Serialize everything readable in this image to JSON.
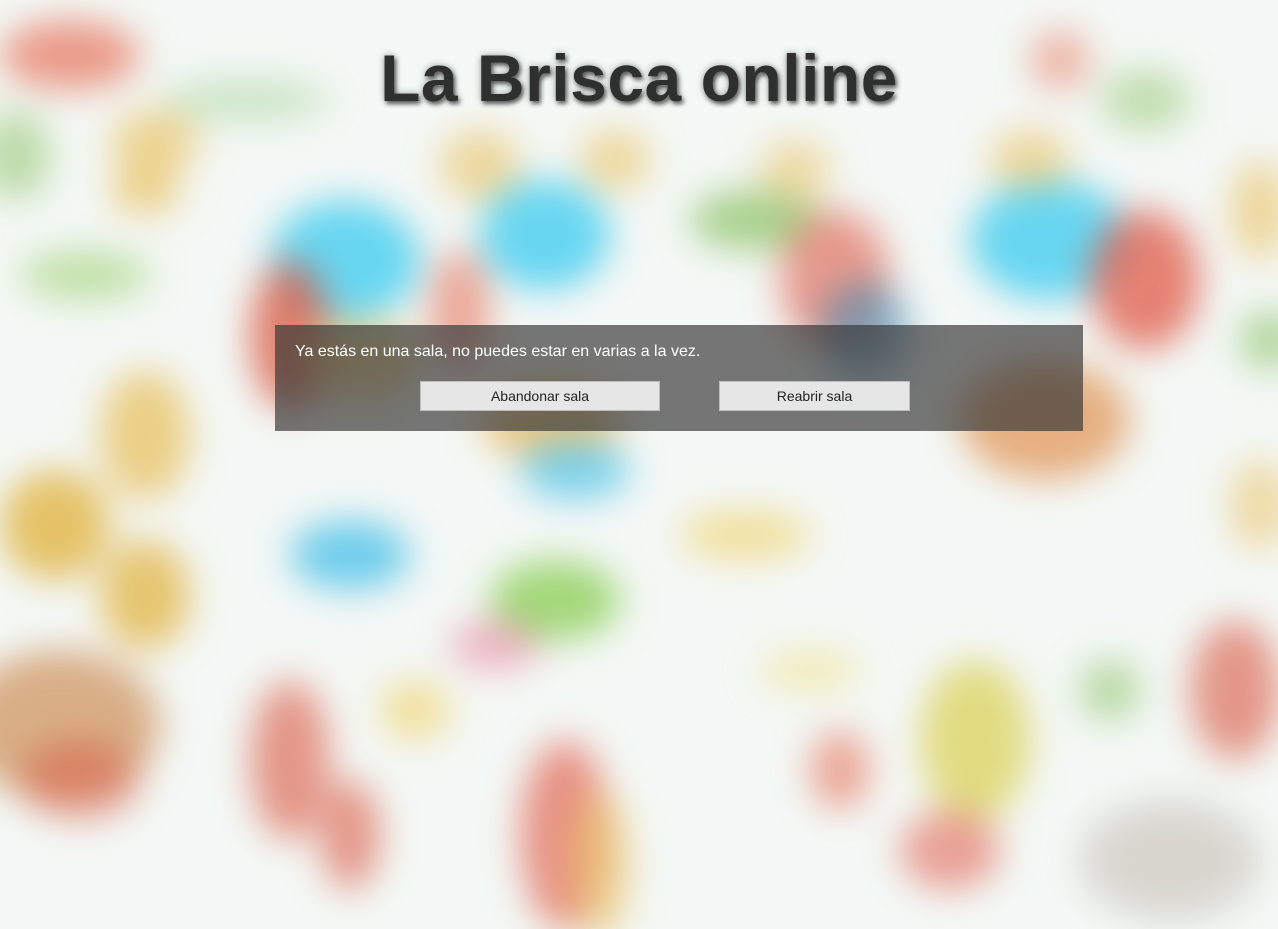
{
  "page": {
    "title": "La Brisca online"
  },
  "dialog": {
    "message": "Ya estás en una sala, no puedes estar en varias a la vez.",
    "buttons": {
      "leave_room": "Abandonar sala",
      "reopen_room": "Reabrir sala"
    }
  },
  "colors": {
    "title_text": "#2f2f2f",
    "dialog_background": "rgba(55,55,55,0.68)",
    "dialog_text": "#ffffff",
    "button_background": "#e6e6e6"
  }
}
